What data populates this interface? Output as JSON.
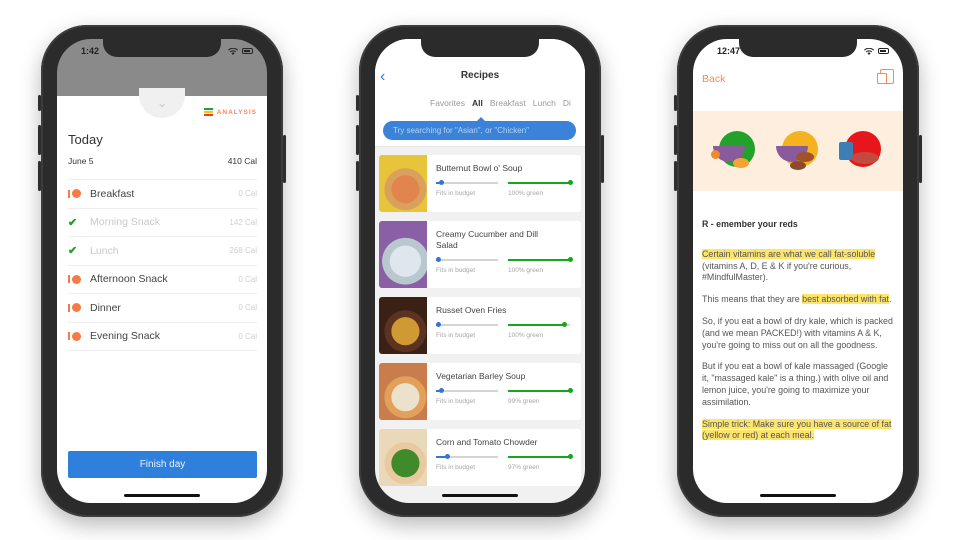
{
  "phone1": {
    "status_time": "1:42",
    "analysis_label": "ANALYSIS",
    "analysis_colors": [
      "#21a523",
      "#f2c319",
      "#ee3b2b"
    ],
    "title": "Today",
    "date": "June 5",
    "total_calories": "410 Cal",
    "meals": [
      {
        "name": "Breakfast",
        "calories": "0 Cal",
        "logged": false
      },
      {
        "name": "Morning Snack",
        "calories": "142 Cal",
        "logged": true
      },
      {
        "name": "Lunch",
        "calories": "268 Cal",
        "logged": true
      },
      {
        "name": "Afternoon Snack",
        "calories": "0 Cal",
        "logged": false
      },
      {
        "name": "Dinner",
        "calories": "0 Cal",
        "logged": false
      },
      {
        "name": "Evening Snack",
        "calories": "0 Cal",
        "logged": false
      }
    ],
    "finish_button": "Finish day",
    "accent_color": "#2f7fdc"
  },
  "phone2": {
    "title": "Recipes",
    "tabs": [
      "Favorites",
      "All",
      "Breakfast",
      "Lunch",
      "Di"
    ],
    "active_tab": "All",
    "search_placeholder": "Try searching for \"Asian\", or \"Chicken\"",
    "budget_label": "Fits in budget",
    "recipes": [
      {
        "name": "Butternut Bowl o' Soup",
        "budget_fraction": 0.08,
        "green_percent": 100,
        "green_label": "100% green",
        "thumb_colors": [
          "#e8c43a",
          "#e2844e",
          "#d9a15c"
        ]
      },
      {
        "name": "Creamy Cucumber and Dill Salad",
        "budget_fraction": 0.03,
        "green_percent": 100,
        "green_label": "100% green",
        "thumb_colors": [
          "#8a5fa5",
          "#dfe7ee",
          "#b9c7cf"
        ]
      },
      {
        "name": "Russet Oven Fries",
        "budget_fraction": 0.03,
        "green_percent": 90,
        "green_label": "100% green",
        "thumb_colors": [
          "#3a2015",
          "#cf9a34",
          "#5b3320"
        ]
      },
      {
        "name": "Vegetarian Barley Soup",
        "budget_fraction": 0.08,
        "green_percent": 100,
        "green_label": "99% green",
        "thumb_colors": [
          "#c97d4d",
          "#ece2cc",
          "#e2a15a"
        ]
      },
      {
        "name": "Corn and Tomato Chowder",
        "budget_fraction": 0.18,
        "green_percent": 100,
        "green_label": "97% green",
        "thumb_colors": [
          "#ead9b8",
          "#3f8a2a",
          "#e9caa0"
        ]
      }
    ]
  },
  "phone3": {
    "status_time": "12:47",
    "back_label": "Back",
    "heading": "R - emember your reds",
    "paragraphs": [
      {
        "highlight": "Certain vitamins are what we call fat-soluble",
        "text": " (vitamins A, D, E & K if you're curious, #MindfulMaster)."
      },
      {
        "text": "This means that they are ",
        "highlight": "best absorbed with fat",
        "tail": "."
      },
      {
        "text": "So, if you eat a bowl of dry kale, which is packed (and we mean PACKED!) with vitamins A & K, you're going to miss out on all the goodness."
      },
      {
        "text": "But if you eat a bowl of kale massaged (Google it, \"massaged kale\" is a thing.) with olive oil and lemon juice, you're going to maximize your assimilation."
      },
      {
        "highlight": "Simple trick: Make sure you have a source of fat (yellow or red) at each meal."
      }
    ],
    "illustration_colors": [
      "#22a22a",
      "#f4b21f",
      "#e8161c"
    ],
    "accent_color": "#f58a5b"
  }
}
